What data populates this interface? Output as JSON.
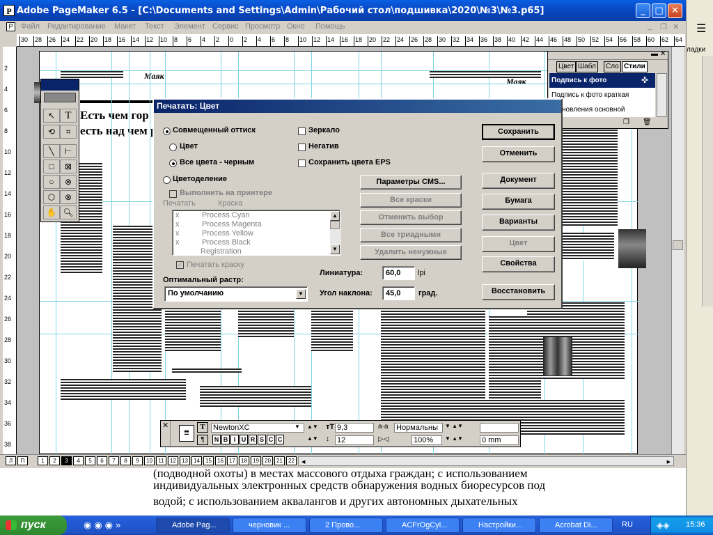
{
  "window": {
    "title": "Adobe PageMaker 6.5 - [C:\\Documents and Settings\\Admin\\Рабочий стол\\подшивка\\2020\\№3\\№3.p65]",
    "minimize_icon": "minimize-icon",
    "maximize_icon": "maximize-icon",
    "close_icon": "close-icon"
  },
  "menu": [
    "Файл",
    "Редактирование",
    "Макет",
    "Текст",
    "Элемент",
    "Сервис",
    "Просмотр",
    "Окно",
    "Помощь"
  ],
  "ruler": {
    "h_ticks": [
      "30",
      "28",
      "26",
      "24",
      "22",
      "20",
      "18",
      "16",
      "14",
      "12",
      "10",
      "8",
      "6",
      "4",
      "2",
      "0",
      "2",
      "4",
      "6",
      "8",
      "10",
      "12",
      "14",
      "16",
      "18",
      "20",
      "22",
      "24",
      "26",
      "28",
      "30",
      "32",
      "34",
      "36",
      "38",
      "40",
      "42",
      "44",
      "46",
      "48",
      "50",
      "52",
      "54",
      "56",
      "58",
      "60",
      "62",
      "64"
    ],
    "v_ticks": [
      "2",
      "4",
      "6",
      "8",
      "10",
      "12",
      "14",
      "16",
      "18",
      "20",
      "22",
      "24",
      "26",
      "28",
      "30",
      "32",
      "34",
      "36",
      "38"
    ]
  },
  "page": {
    "header_left": "Маяк",
    "header_right": "Маяк",
    "headline1": "Есть чем гор",
    "headline2": "есть над чем р"
  },
  "styles_palette": {
    "tabs": [
      "Цвет",
      "Шабл",
      "Сло",
      "Стили"
    ],
    "items": [
      "Подпись к фото",
      "Подпись к фото  краткая",
      "становления  основной"
    ]
  },
  "dialog": {
    "title": "Печатать: Цвет",
    "composite": "Совмещенный оттиск",
    "color": "Цвет",
    "all_black": "Все цвета - черным",
    "separations": "Цветоделение",
    "on_printer": "Выполнить на принтере",
    "col_print": "Печатать",
    "col_ink": "Краска",
    "inks": [
      {
        "mark": "x",
        "name": "Process Cyan"
      },
      {
        "mark": "x",
        "name": "Process Magenta"
      },
      {
        "mark": "x",
        "name": "Process Yellow"
      },
      {
        "mark": "x",
        "name": "Process Black"
      },
      {
        "mark": "",
        "name": "Registration"
      }
    ],
    "print_ink": "Печатать краску",
    "optimal_screen": "Оптимальный растр:",
    "screen_value": "По умолчанию",
    "mirror": "Зеркало",
    "negative": "Негатив",
    "preserve_eps": "Сохранить цвета EPS",
    "cms_button": "Параметры CMS...",
    "all_to_process": "Все краски",
    "revert": "Отменить выбор",
    "all_triad": "Все триадными",
    "remove_unused": "Удалить ненужные",
    "ruling_label": "Линиатура:",
    "ruling_value": "60,0",
    "ruling_unit": "lpi",
    "angle_label": "Угол наклона:",
    "angle_value": "45,0",
    "angle_unit": "град.",
    "buttons": [
      "Сохранить",
      "Отменить",
      "Документ",
      "Бумага",
      "Варианты",
      "Цвет",
      "Свойства",
      "Восстановить"
    ]
  },
  "control": {
    "font": "NewtonXC",
    "size": "9,3",
    "leading": "12",
    "style": "Нормальны",
    "scale": "100%",
    "kern": "0 mm",
    "style_buttons": [
      "N",
      "B",
      "I",
      "U",
      "R",
      "S",
      "C",
      "C"
    ]
  },
  "bottom": {
    "pages": [
      "1",
      "2",
      "3",
      "4",
      "5",
      "6",
      "7",
      "8",
      "9",
      "10",
      "11",
      "12",
      "13",
      "14",
      "15",
      "16",
      "17",
      "18",
      "19",
      "20",
      "21",
      "22"
    ],
    "selected": "3",
    "master_left": "Л",
    "master_right": "П"
  },
  "background": {
    "line1": "(подводной охоты) в местах массового отдыха граждан; с использованием",
    "line2": "индивидуальных электронных средств обнаружения водных биоресурсов под",
    "line3": "водой; с использованием аквалангов и других автономных дыхательных",
    "right_label": "ладки"
  },
  "taskbar": {
    "start": "пуск",
    "tasks": [
      "Adobe Pag...",
      "черновик ...",
      "2 Прово...",
      "ACFrOgCyl...",
      "Настройки...",
      "Acrobat Di..."
    ],
    "lang": "RU",
    "clock": "15:36"
  }
}
